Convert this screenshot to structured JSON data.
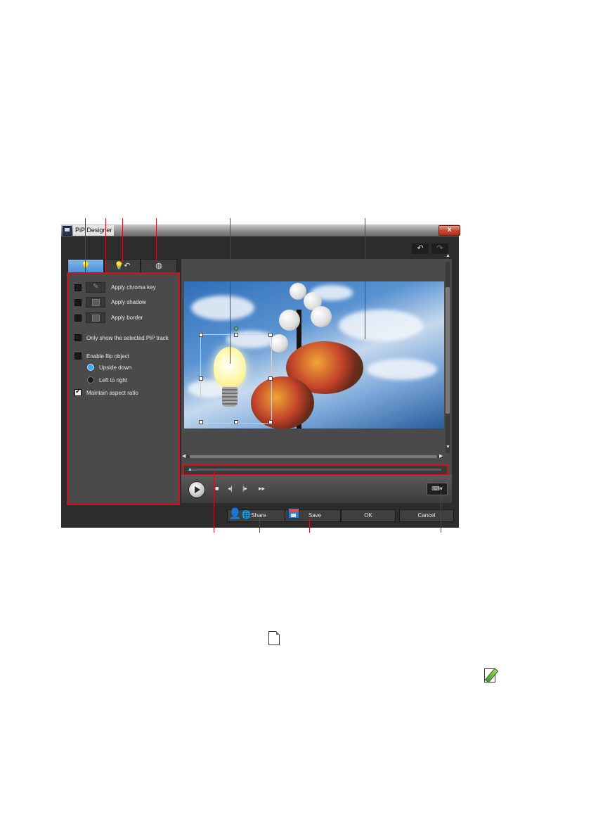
{
  "window": {
    "title": "PiP Designer",
    "close_label": "x"
  },
  "tabs": [
    {
      "label": "💡",
      "icon": "lightbulb-icon"
    },
    {
      "label": "💡↶",
      "icon": "motion-path-icon"
    },
    {
      "label": "◍",
      "icon": "mask-icon"
    }
  ],
  "options": {
    "chroma_key": "Apply chroma key",
    "shadow": "Apply shadow",
    "border": "Apply border",
    "only_selected": "Only show the selected PiP track",
    "flip": "Enable flip object",
    "upside_down": "Upside down",
    "left_right": "Left to right",
    "aspect": "Maintain aspect ratio"
  },
  "toolbar": {
    "undo": "↶",
    "redo": "↷"
  },
  "playback": {
    "stop": "■",
    "prev_frame": "◂|",
    "next_frame": "|▸",
    "fast_forward": "▸▸",
    "keyboard": "⌨▾"
  },
  "buttons": {
    "share": "Share",
    "save": "Save",
    "ok": "OK",
    "cancel": "Cancel"
  },
  "colors": {
    "callout": "#c4161c",
    "tab_active": "#4a8fd6",
    "radio_on": "#3fa9f5"
  }
}
